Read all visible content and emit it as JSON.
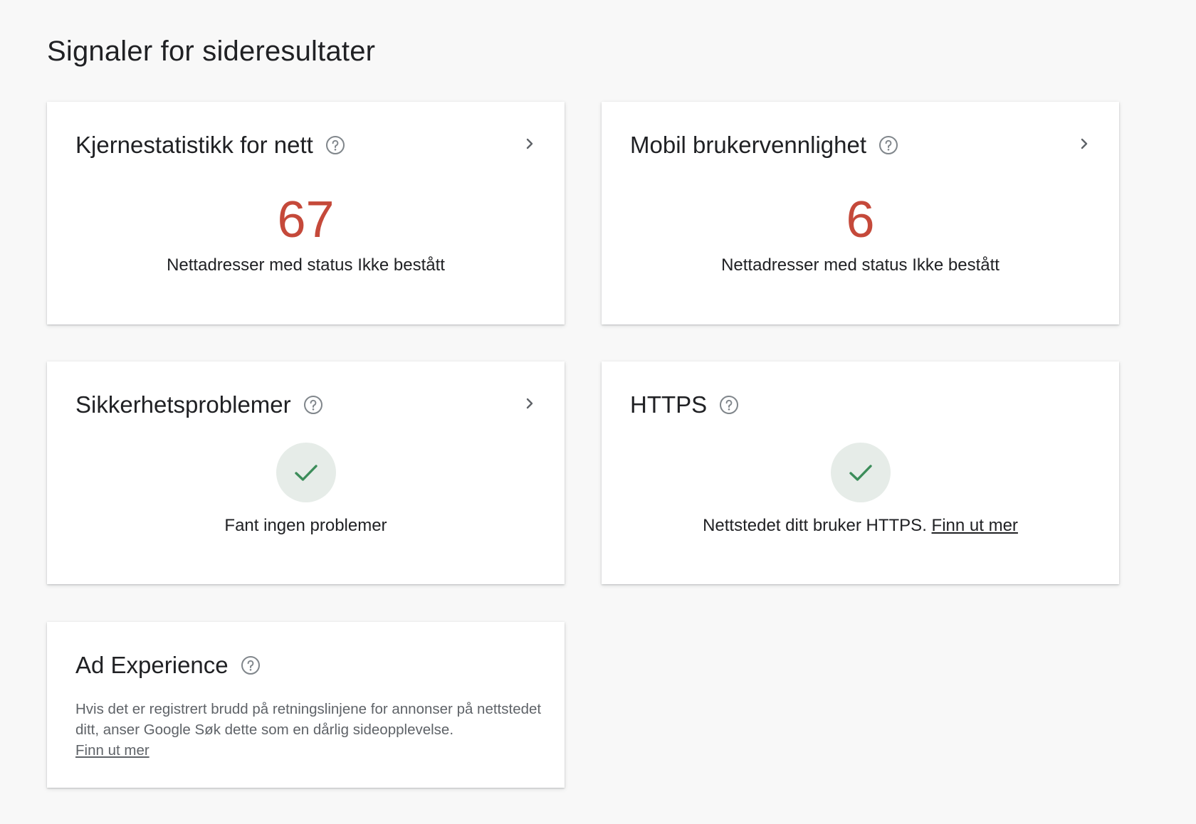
{
  "page": {
    "title": "Signaler for sideresultater"
  },
  "icons": {
    "help": "help-circle-icon",
    "chevron": "chevron-right-icon",
    "check": "check-icon"
  },
  "colors": {
    "error_number": "#c5493a",
    "check": "#3c8d5a",
    "check_bg": "#e6ece8"
  },
  "cards": {
    "cwv": {
      "title": "Kjernestatistikk for nett",
      "value": "67",
      "label": "Nettadresser med status Ikke bestått"
    },
    "mobile": {
      "title": "Mobil brukervennlighet",
      "value": "6",
      "label": "Nettadresser med status Ikke bestått"
    },
    "security": {
      "title": "Sikkerhetsproblemer",
      "status": "Fant ingen problemer"
    },
    "https": {
      "title": "HTTPS",
      "status": "Nettstedet ditt bruker HTTPS.",
      "link": "Finn ut mer"
    },
    "ad": {
      "title": "Ad Experience",
      "description": "Hvis det er registrert brudd på retningslinjene for annonser på nettstedet ditt, anser Google Søk dette som en dårlig sideopplevelse.",
      "link": "Finn ut mer"
    }
  }
}
